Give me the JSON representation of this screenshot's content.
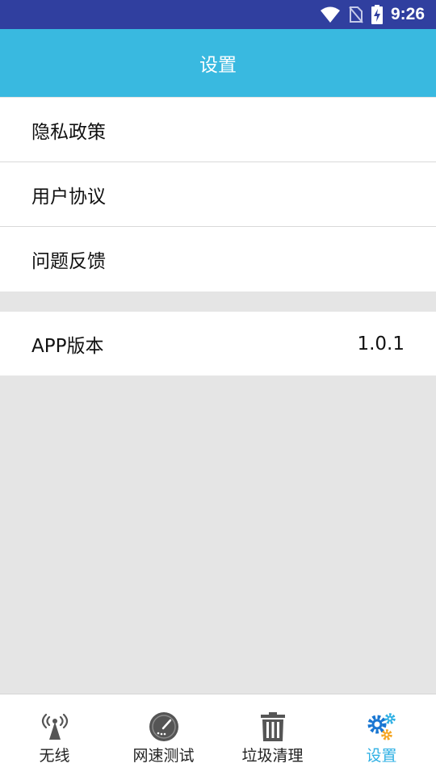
{
  "status_bar": {
    "time": "9:26"
  },
  "header": {
    "title": "设置"
  },
  "menu": {
    "items": [
      {
        "label": "隐私政策"
      },
      {
        "label": "用户协议"
      },
      {
        "label": "问题反馈"
      }
    ]
  },
  "version": {
    "label": "APP版本",
    "value": "1.0.1"
  },
  "tabbar": {
    "tabs": [
      {
        "label": "无线",
        "icon": "wifi-signal-icon"
      },
      {
        "label": "网速测试",
        "icon": "speedometer-icon"
      },
      {
        "label": "垃圾清理",
        "icon": "trash-icon"
      },
      {
        "label": "设置",
        "icon": "gears-icon"
      }
    ],
    "active_color": "#2fb0e4"
  },
  "colors": {
    "status_bar": "#303f9f",
    "header": "#39b9e0",
    "background": "#e5e5e5"
  }
}
